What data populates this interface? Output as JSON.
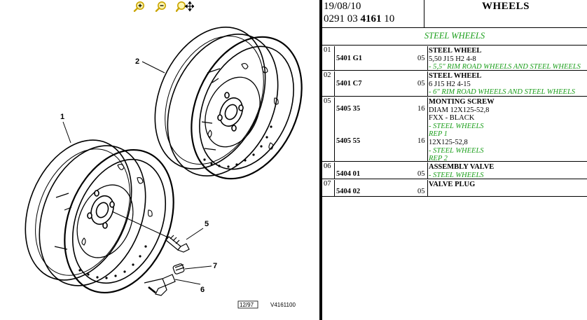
{
  "toolbar": {
    "zoom_in_icon": "magnifier-plus-icon",
    "zoom_out_icon": "magnifier-minus-icon",
    "zoom_pan_icon": "magnifier-move-icon",
    "icon_color": "#e8c200"
  },
  "diagram": {
    "callouts": [
      "1",
      "2",
      "5",
      "6",
      "7"
    ],
    "sheet_ref": "12/97",
    "drawing_code": "V4161100"
  },
  "header": {
    "date": "19/08/10",
    "ref_prefix": "0291 03 ",
    "ref_bold": "4161",
    "ref_suffix": " 10",
    "title": "WHEELS"
  },
  "section": {
    "title": "STEEL WHEELS",
    "color": "#1a9e1a"
  },
  "rows": [
    {
      "num": "01",
      "ref": "5401 G1",
      "qty": "05",
      "lines": [
        "STEEL WHEEL",
        "5,50 J15 H2 4-8",
        "- 5,5\" RIM ROAD WHEELS AND STEEL WHEELS"
      ]
    },
    {
      "num": "02",
      "ref": "5401 C7",
      "qty": "05",
      "lines": [
        "STEEL WHEEL",
        "6 J15 H2 4-15",
        "- 6\" RIM ROAD WHEELS AND STEEL WHEELS"
      ]
    },
    {
      "num": "05",
      "ref": "5405 35",
      "qty": "16",
      "lines": [
        "MONTING SCREW",
        "DIAM 12X125-52,8",
        "FXX - BLACK",
        "- STEEL WHEELS",
        "REP 1"
      ],
      "ref2": "5405 55",
      "qty2": "16",
      "lines2": [
        "12X125-52,8",
        "- STEEL WHEELS",
        "REP 2"
      ]
    },
    {
      "num": "06",
      "ref": "5404 01",
      "qty": "05",
      "lines": [
        "ASSEMBLY VALVE",
        "- STEEL WHEELS"
      ]
    },
    {
      "num": "07",
      "ref": "5404 02",
      "qty": "05",
      "lines": [
        "VALVE PLUG"
      ]
    }
  ]
}
